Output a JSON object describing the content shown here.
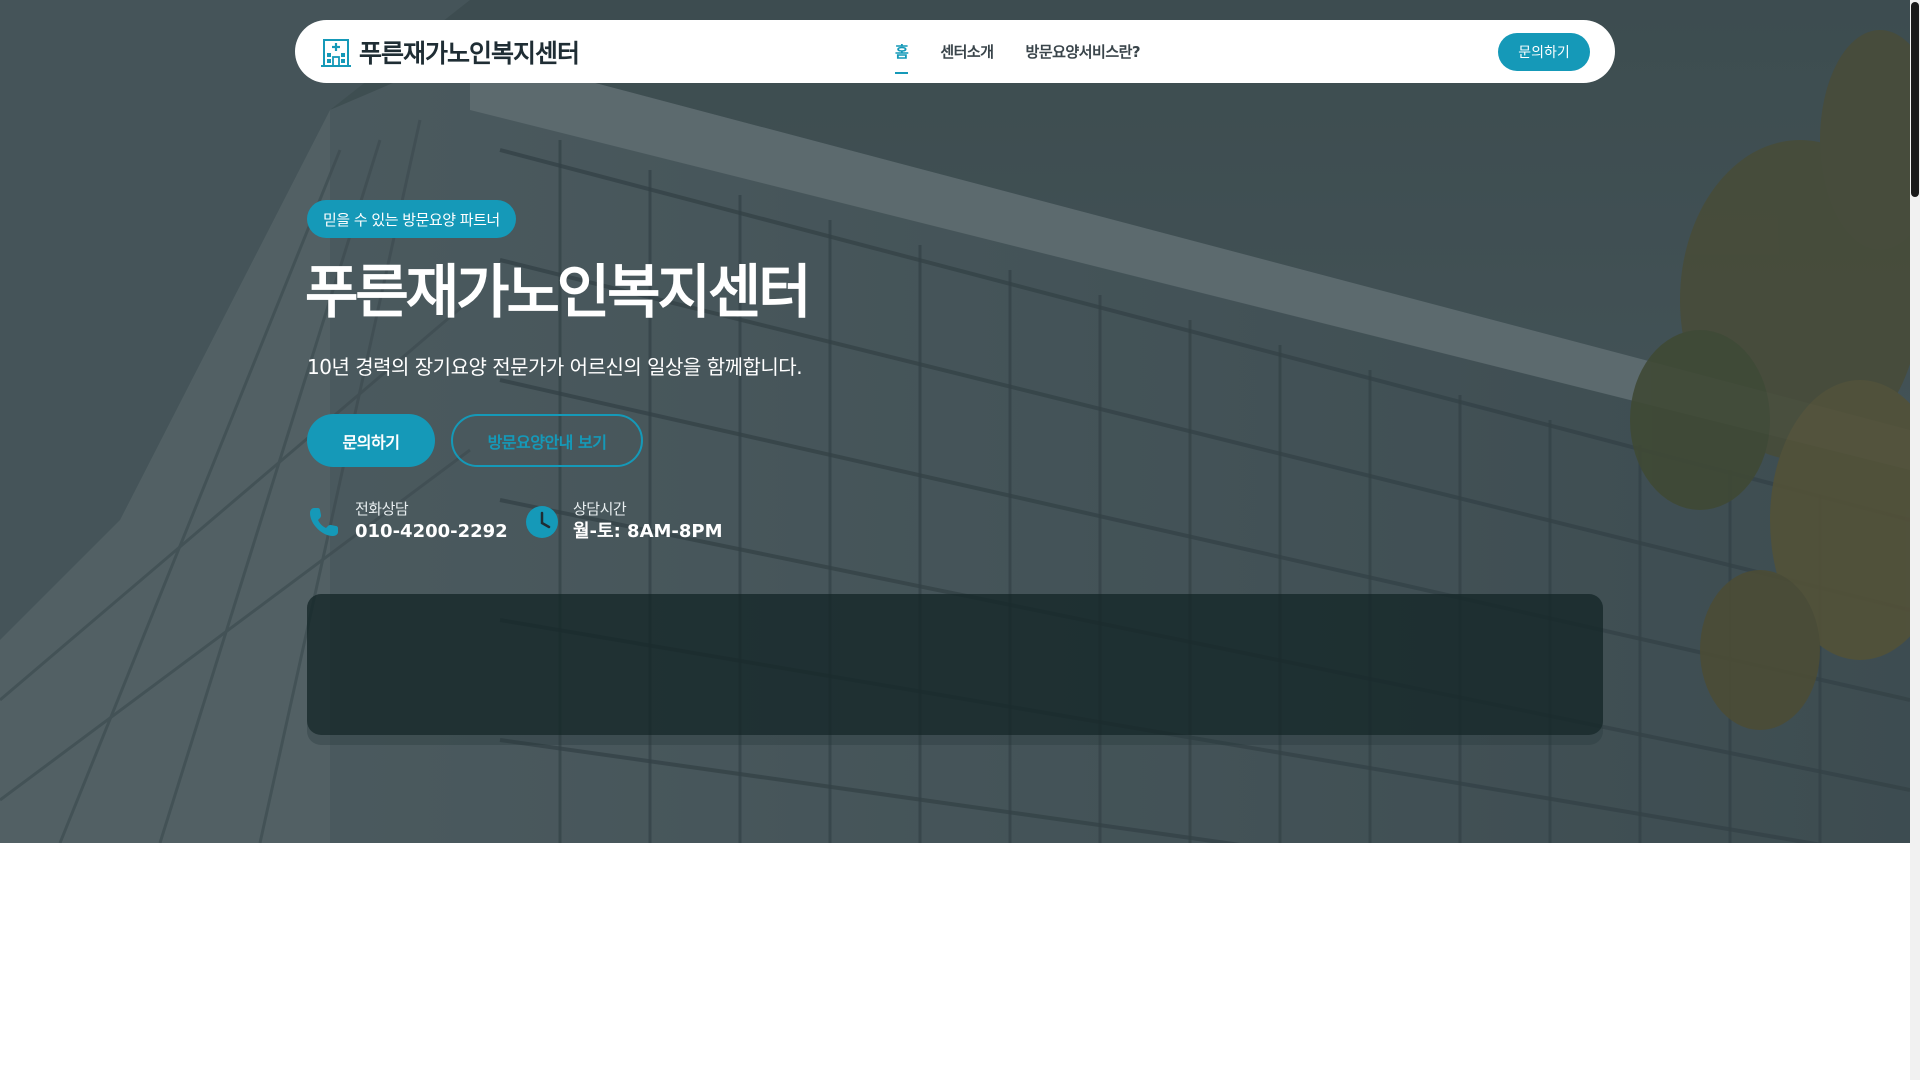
{
  "colors": {
    "accent": "#1599b8",
    "nav_text": "#3a454b",
    "brand_text": "#1f2d34",
    "overlay": "#3f4f52"
  },
  "navbar": {
    "brand_name": "푸른재가노인복지센터",
    "brand_icon": "building-icon",
    "items": [
      {
        "label": "홈",
        "active": true
      },
      {
        "label": "센터소개",
        "active": false
      },
      {
        "label": "방문요양서비스란?",
        "active": false
      }
    ],
    "cta_label": "문의하기"
  },
  "hero": {
    "badge": "믿을 수 있는 방문요양 파트너",
    "title": "푸른재가노인복지센터",
    "subtitle": "10년 경력의 장기요양 전문가가 어르신의 일상을 함께합니다.",
    "primary_button": "문의하기",
    "secondary_button": "방문요양안내 보기",
    "contacts": [
      {
        "icon": "phone-icon",
        "label": "전화상담",
        "value": "010-4200-2292"
      },
      {
        "icon": "clock-icon",
        "label": "상담시간",
        "value": "월-토: 8AM-8PM"
      }
    ]
  }
}
